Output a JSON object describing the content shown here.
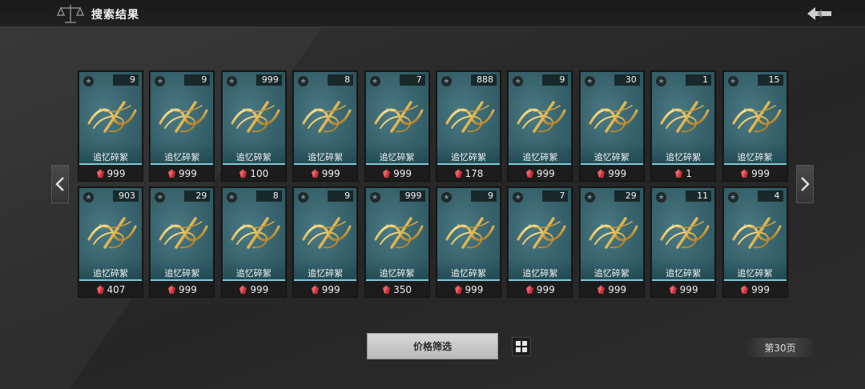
{
  "header": {
    "title": "搜索结果"
  },
  "filter": {
    "label": "价格筛选"
  },
  "pagination": {
    "page_label": "第30页"
  },
  "colors": {
    "accent": "#7fc8d6",
    "card_bg": "#3a6670",
    "gem": "#c8323c"
  },
  "icons": {
    "logo": "scale-icon",
    "back": "back-arrow-icon",
    "prev": "chevron-left-icon",
    "next": "chevron-right-icon",
    "grid": "grid-view-icon",
    "currency": "red-gem-icon",
    "item_emblem": "golden-ribbon-icon"
  },
  "items": [
    {
      "name": "追忆碎絮",
      "count": "9",
      "price": "999"
    },
    {
      "name": "追忆碎絮",
      "count": "9",
      "price": "999"
    },
    {
      "name": "追忆碎絮",
      "count": "999",
      "price": "100"
    },
    {
      "name": "追忆碎絮",
      "count": "8",
      "price": "999"
    },
    {
      "name": "追忆碎絮",
      "count": "7",
      "price": "999"
    },
    {
      "name": "追忆碎絮",
      "count": "888",
      "price": "178"
    },
    {
      "name": "追忆碎絮",
      "count": "9",
      "price": "999"
    },
    {
      "name": "追忆碎絮",
      "count": "30",
      "price": "999"
    },
    {
      "name": "追忆碎絮",
      "count": "1",
      "price": "1"
    },
    {
      "name": "追忆碎絮",
      "count": "15",
      "price": "999"
    },
    {
      "name": "追忆碎絮",
      "count": "903",
      "price": "407"
    },
    {
      "name": "追忆碎絮",
      "count": "29",
      "price": "999"
    },
    {
      "name": "追忆碎絮",
      "count": "8",
      "price": "999"
    },
    {
      "name": "追忆碎絮",
      "count": "9",
      "price": "999"
    },
    {
      "name": "追忆碎絮",
      "count": "999",
      "price": "350"
    },
    {
      "name": "追忆碎絮",
      "count": "9",
      "price": "999"
    },
    {
      "name": "追忆碎絮",
      "count": "7",
      "price": "999"
    },
    {
      "name": "追忆碎絮",
      "count": "29",
      "price": "999"
    },
    {
      "name": "追忆碎絮",
      "count": "11",
      "price": "999"
    },
    {
      "name": "追忆碎絮",
      "count": "4",
      "price": "999"
    }
  ]
}
